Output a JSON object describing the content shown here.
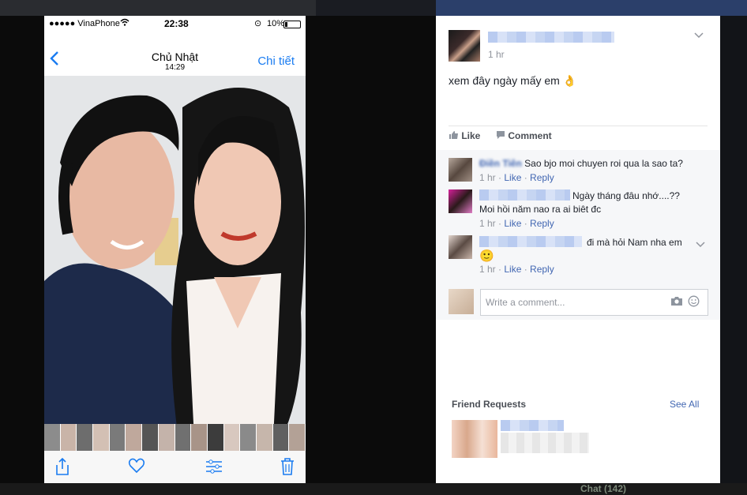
{
  "phone": {
    "status": {
      "carrier": "●●●●● VinaPhone",
      "time": "22:38",
      "battery": "10%"
    },
    "nav": {
      "back_label": "<",
      "title": "Chủ Nhật",
      "subtitle": "14:29",
      "detail_label": "Chi tiết"
    },
    "accent": "#1a7cf1",
    "toolbar": [
      "share-icon",
      "heart-icon",
      "sliders-icon",
      "trash-icon"
    ]
  },
  "fb": {
    "post": {
      "time": "1 hr",
      "text": "xem đây ngày mấy em 👌"
    },
    "actions": {
      "like": "Like",
      "comment": "Comment"
    },
    "comments": [
      {
        "author": "Điền Tiên",
        "text": "Sao bjo moi chuyen roi qua la sao ta?",
        "time": "1 hr",
        "like": "Like",
        "reply": "Reply"
      },
      {
        "text": "Ngày tháng đâu nhớ....??",
        "text2": "Moi hồi năm nao ra ai biêt đc",
        "time": "1 hr",
        "like": "Like",
        "reply": "Reply"
      },
      {
        "text": "đi mà hỏi Nam nha em",
        "emoji": "🙂",
        "time": "1 hr",
        "like": "Like",
        "reply": "Reply"
      }
    ],
    "input": {
      "placeholder": "Write a comment..."
    },
    "friend_requests": {
      "title": "Friend Requests",
      "see_all": "See All"
    },
    "accent": "#4267b2"
  },
  "bottom": {
    "chat": "Chat (142)"
  }
}
